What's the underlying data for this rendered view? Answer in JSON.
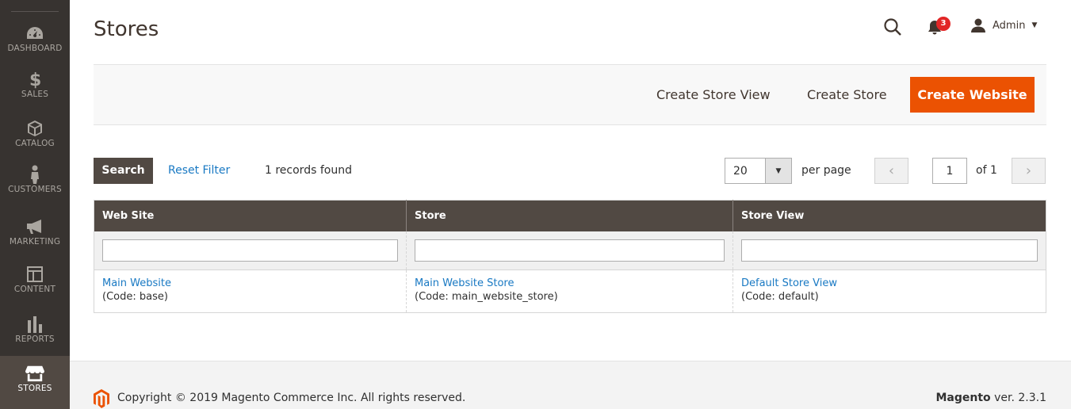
{
  "sidebar": {
    "items": [
      {
        "label": "DASHBOARD",
        "icon": "dashboard-icon"
      },
      {
        "label": "SALES",
        "icon": "dollar-icon"
      },
      {
        "label": "CATALOG",
        "icon": "box-icon"
      },
      {
        "label": "CUSTOMERS",
        "icon": "person-icon"
      },
      {
        "label": "MARKETING",
        "icon": "megaphone-icon"
      },
      {
        "label": "CONTENT",
        "icon": "layout-icon"
      },
      {
        "label": "REPORTS",
        "icon": "bar-chart-icon"
      },
      {
        "label": "STORES",
        "icon": "storefront-icon",
        "active": true
      }
    ]
  },
  "header": {
    "title": "Stores",
    "notifications_count": "3",
    "user_name": "Admin"
  },
  "actions": {
    "create_store_view": "Create Store View",
    "create_store": "Create Store",
    "create_website": "Create Website"
  },
  "toolbar": {
    "search_label": "Search",
    "reset_label": "Reset Filter",
    "records_found": "1 records found",
    "per_page_value": "20",
    "per_page_label": "per page",
    "page_current": "1",
    "page_of": "of 1"
  },
  "grid": {
    "columns": [
      "Web Site",
      "Store",
      "Store View"
    ],
    "rows": [
      {
        "website": {
          "name": "Main Website",
          "code": "(Code: base)"
        },
        "store": {
          "name": "Main Website Store",
          "code": "(Code: main_website_store)"
        },
        "store_view": {
          "name": "Default Store View",
          "code": "(Code: default)"
        }
      }
    ]
  },
  "footer": {
    "copyright": "Copyright © 2019 Magento Commerce Inc. All rights reserved.",
    "brand": "Magento",
    "version": " ver. 2.3.1"
  },
  "colors": {
    "sidebar_bg": "#373330",
    "active_bg": "#514943",
    "accent": "#eb5202",
    "link": "#1979c3",
    "badge": "#e22626"
  }
}
